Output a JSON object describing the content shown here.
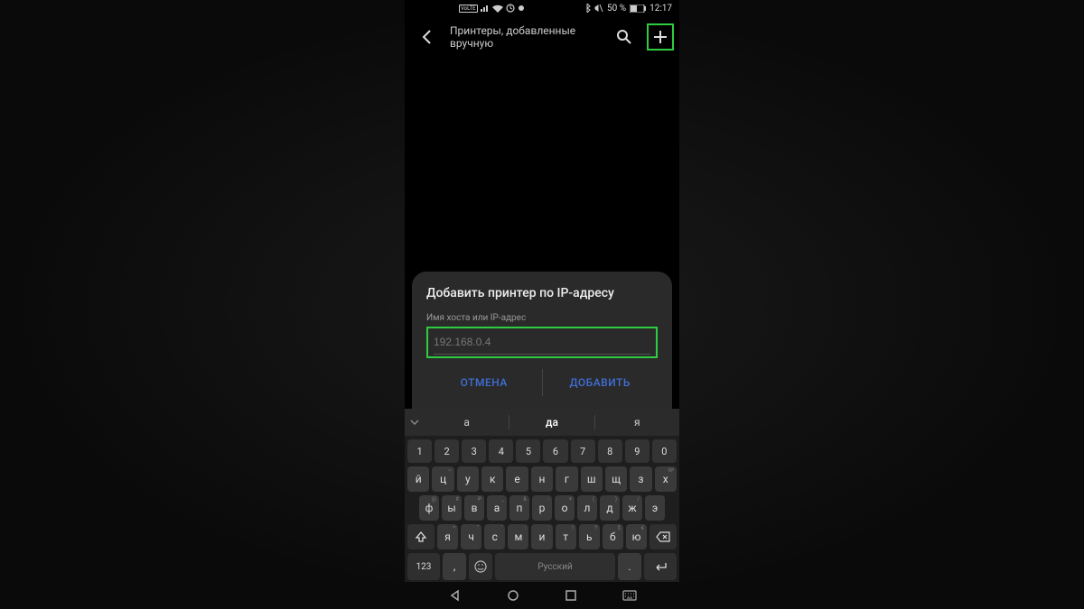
{
  "statusbar": {
    "volte": "VoLTE",
    "battery_text": "50 %",
    "time": "12:17"
  },
  "appbar": {
    "title": "Принтеры, добавленные вручную"
  },
  "dialog": {
    "title": "Добавить принтер по IP-адресу",
    "label": "Имя хоста или IP-адрес",
    "placeholder": "192.168.0.4",
    "cancel": "ОТМЕНА",
    "add": "ДОБАВИТЬ"
  },
  "suggestions": {
    "s1": "а",
    "s2": "да",
    "s3": "я"
  },
  "keyboard": {
    "numbers": [
      "1",
      "2",
      "3",
      "4",
      "5",
      "6",
      "7",
      "8",
      "9",
      "0"
    ],
    "row1": [
      {
        "k": "й",
        "a": ""
      },
      {
        "k": "ц",
        "a": "~"
      },
      {
        "k": "у",
        "a": ""
      },
      {
        "k": "к",
        "a": ""
      },
      {
        "k": "е",
        "a": ""
      },
      {
        "k": "н",
        "a": ""
      },
      {
        "k": "г",
        "a": ""
      },
      {
        "k": "ш",
        "a": ""
      },
      {
        "k": "щ",
        "a": ""
      },
      {
        "k": "з",
        "a": ""
      },
      {
        "k": "х",
        "a": "№"
      }
    ],
    "row2": [
      {
        "k": "ф",
        "a": "@"
      },
      {
        "k": "ы",
        "a": "#"
      },
      {
        "k": "в",
        "a": "₽"
      },
      {
        "k": "а",
        "a": "_"
      },
      {
        "k": "п",
        "a": "&"
      },
      {
        "k": "р",
        "a": "-"
      },
      {
        "k": "о",
        "a": "+"
      },
      {
        "k": "л",
        "a": "("
      },
      {
        "k": "д",
        "a": ")"
      },
      {
        "k": "ж",
        "a": "/"
      },
      {
        "k": "э",
        "a": ""
      }
    ],
    "row3": [
      {
        "k": "я",
        "a": "*"
      },
      {
        "k": "ч",
        "a": "\""
      },
      {
        "k": "с",
        "a": "'"
      },
      {
        "k": "м",
        "a": ":"
      },
      {
        "k": "и",
        "a": ";"
      },
      {
        "k": "т",
        "a": "!"
      },
      {
        "k": "ь",
        "a": "?"
      },
      {
        "k": "б",
        "a": "$"
      },
      {
        "k": "ю",
        "a": "€"
      }
    ],
    "k123": "123",
    "space": "Русский",
    "comma": ",",
    "dot": "."
  }
}
